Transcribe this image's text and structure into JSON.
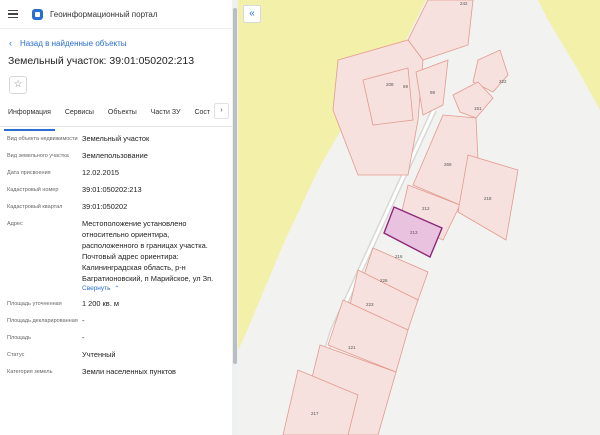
{
  "app": {
    "title": "Геоинформационный портал"
  },
  "nav": {
    "back_label": "Назад в найденные объекты"
  },
  "object": {
    "title": "Земельный участок: 39:01:050202:213"
  },
  "tabs": [
    {
      "label": "Информация",
      "active": true
    },
    {
      "label": "Сервисы",
      "active": false
    },
    {
      "label": "Объекты",
      "active": false
    },
    {
      "label": "Части ЗУ",
      "active": false
    },
    {
      "label": "Сост",
      "active": false
    }
  ],
  "attributes": [
    {
      "label": "Вид объекта недвижимости",
      "value": "Земельный участок"
    },
    {
      "label": "Вид земельного участка",
      "value": "Землепользование"
    },
    {
      "label": "Дата присвоения",
      "value": "12.02.2015"
    },
    {
      "label": "Кадастровый номер",
      "value": "39:01:050202:213"
    },
    {
      "label": "Кадастровый квартал",
      "value": "39:01:050202"
    },
    {
      "label": "Адрес",
      "value": "Местоположение установлено относительно ориентира, расположенного в границах участка. Почтовый адрес ориентира: Калининградская область, р-н Багратионовский, п Марийское, ул Зп."
    },
    {
      "label": "Площадь уточненная",
      "value": "1 200 кв. м"
    },
    {
      "label": "Площадь декларированная",
      "value": "-"
    },
    {
      "label": "Площадь",
      "value": "-"
    },
    {
      "label": "Статус",
      "value": "Учтенный"
    },
    {
      "label": "Категория земель",
      "value": "Земли населенных пунктов"
    }
  ],
  "expand_label": "Свернуть",
  "icons": {
    "menu": "hamburger-icon",
    "logo": "portal-logo-icon",
    "back": "chevron-left-icon",
    "star": "star-icon",
    "next": "chevron-right-icon",
    "collapse": "double-chevron-left-icon"
  },
  "colors": {
    "accent": "#2a6ecf",
    "parcel_fill": "#f6e1df",
    "parcel_stroke": "#e39a8e",
    "selected_fill": "#e8c2df",
    "selected_stroke": "#8b2a7a",
    "map_yellow": "#f3f0a9"
  },
  "map": {
    "parcel_labels": [
      "242",
      "208",
      "69",
      "98",
      "222",
      "151",
      "269",
      "212",
      "218",
      "213",
      "216",
      "226",
      "223",
      "121",
      "217"
    ],
    "selected_label": "213"
  }
}
